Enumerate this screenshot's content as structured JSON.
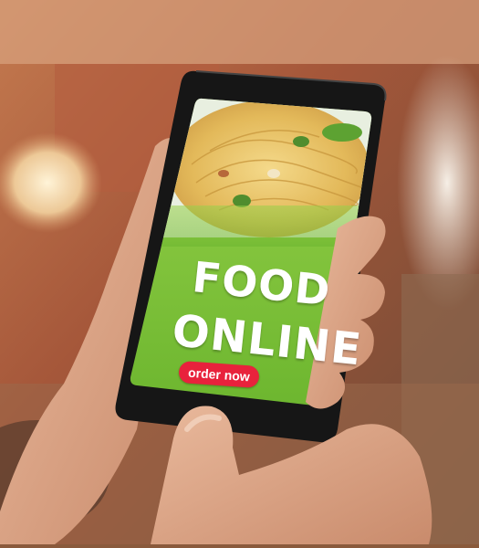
{
  "app": {
    "headline_line1": "FOOD",
    "headline_line2": "ONLINE",
    "cta_label": "order now"
  },
  "colors": {
    "screen_green": "#7cc43a",
    "cta_red": "#e8223c",
    "phone_body": "#1a1a1a"
  },
  "icons": [
    "pasta-dish-photo"
  ]
}
